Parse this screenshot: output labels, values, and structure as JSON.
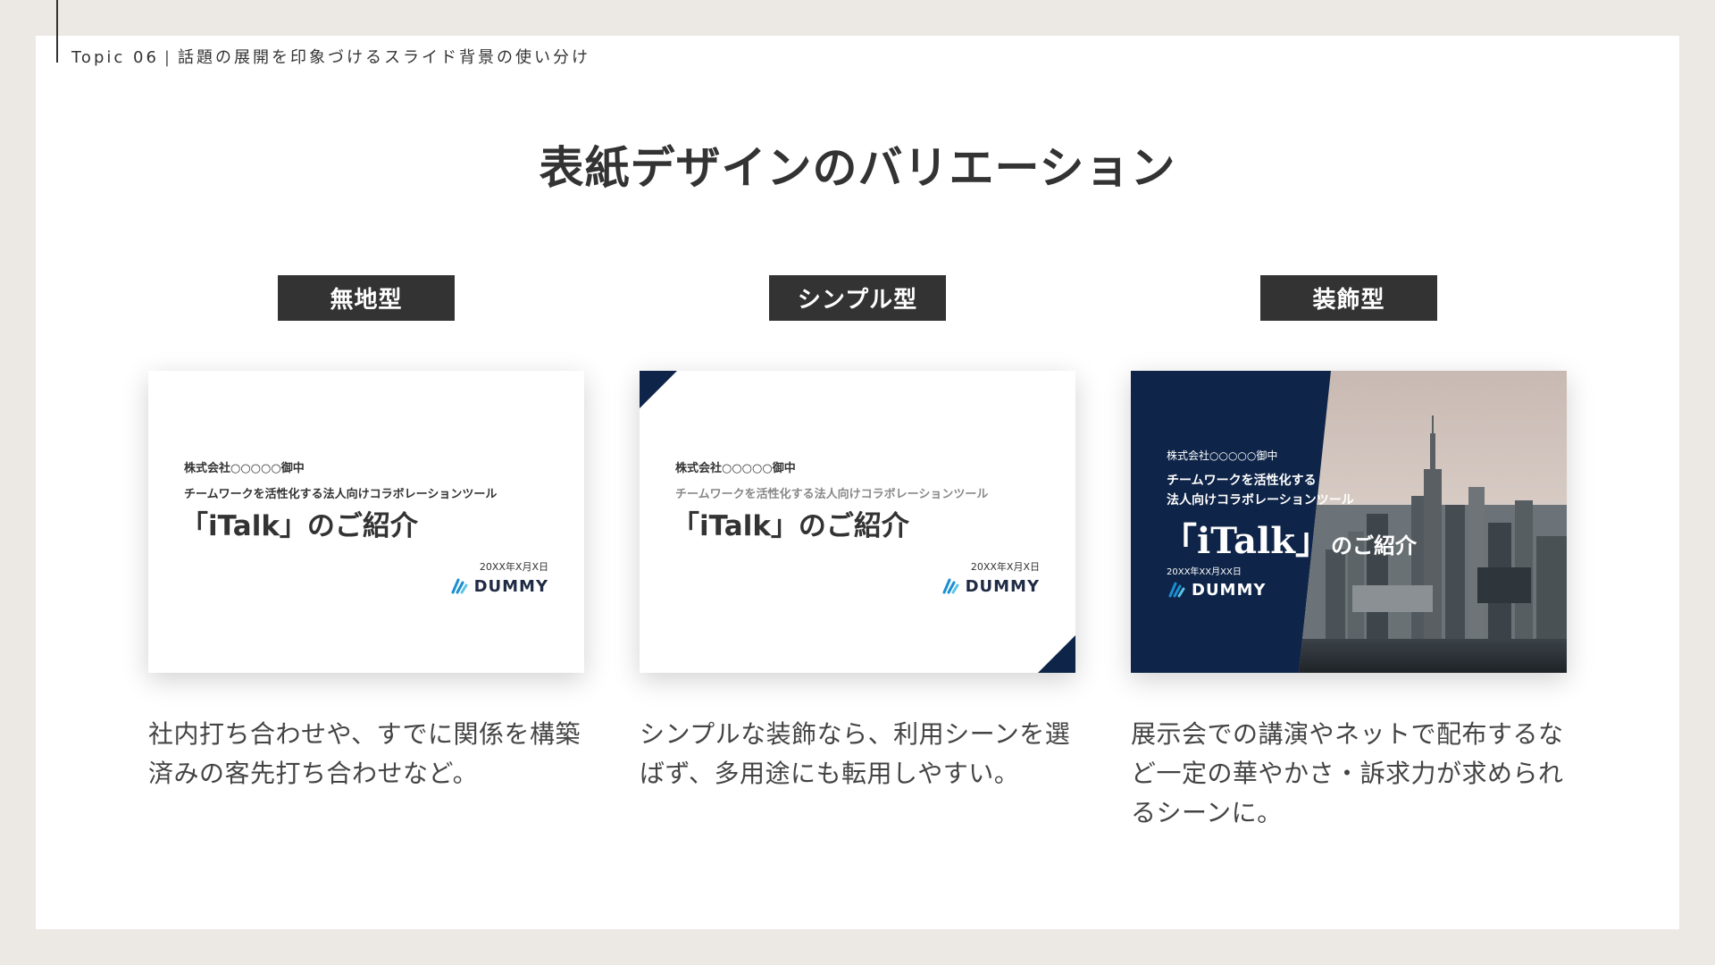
{
  "header": {
    "topic_label": "Topic 06",
    "separator": "|",
    "topic_title": "話題の展開を印象づけるスライド背景の使い分け"
  },
  "title": "表紙デザインのバリエーション",
  "columns": [
    {
      "label": "無地型",
      "description": "社内打ち合わせや、すでに関係を構築済みの客先打ち合わせなど。",
      "card": {
        "company": "株式会社○○○○○御中",
        "subtitle": "チームワークを活性化する法人向けコラボレーションツール",
        "title": "「iTalk」のご紹介",
        "date": "20XX年X月X日",
        "logo": "DUMMY"
      }
    },
    {
      "label": "シンプル型",
      "description": "シンプルな装飾なら、利用シーンを選ばず、多用途にも転用しやすい。",
      "card": {
        "company": "株式会社○○○○○御中",
        "subtitle": "チームワークを活性化する法人向けコラボレーションツール",
        "title": "「iTalk」のご紹介",
        "date": "20XX年X月X日",
        "logo": "DUMMY"
      }
    },
    {
      "label": "装飾型",
      "description": "展示会での講演やネットで配布するなど一定の華やかさ・訴求力が求められるシーンに。",
      "card": {
        "company": "株式会社○○○○○御中",
        "subtitle_line1": "チームワークを活性化する",
        "subtitle_line2": "法人向けコラボレーションツール",
        "title_main": "「iTalk」",
        "title_rest": "のご紹介",
        "date": "20XX年XX月XX日",
        "logo": "DUMMY"
      }
    }
  ],
  "colors": {
    "background": "#ece8e4",
    "panel": "#ffffff",
    "label_bg": "#333333",
    "navy": "#0e2448",
    "logo_accent": "#1a8fd1"
  },
  "icons": [
    "dummy-logo-icon",
    "city-photo"
  ]
}
